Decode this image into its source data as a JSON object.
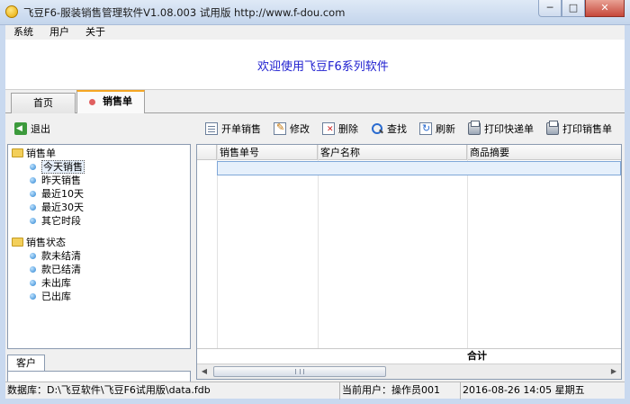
{
  "window": {
    "title": "飞豆F6-服装销售管理软件V1.08.003 试用版 http://www.f-dou.com",
    "controls": {
      "minimize": "─",
      "maximize": "□",
      "close": "✕"
    }
  },
  "menu": [
    "系统",
    "用户",
    "关于"
  ],
  "banner": {
    "welcome": "欢迎使用飞豆F6系列软件"
  },
  "tabs": [
    {
      "label": "首页",
      "active": false
    },
    {
      "label": "销售单",
      "active": true
    }
  ],
  "toolbar": {
    "exit": "退出",
    "buttons": [
      {
        "label": "开单销售",
        "icon": "new-doc-icon"
      },
      {
        "label": "修改",
        "icon": "edit-icon"
      },
      {
        "label": "删除",
        "icon": "delete-icon"
      },
      {
        "label": "查找",
        "icon": "search-icon"
      },
      {
        "label": "刷新",
        "icon": "refresh-icon"
      },
      {
        "label": "打印快递单",
        "icon": "printer-icon"
      },
      {
        "label": "打印销售单",
        "icon": "printer-icon"
      }
    ]
  },
  "tree": {
    "groups": [
      {
        "label": "销售单",
        "items": [
          "今天销售",
          "昨天销售",
          "最近10天",
          "最近30天",
          "其它时段"
        ],
        "selected": 0
      },
      {
        "label": "销售状态",
        "items": [
          "款未结清",
          "款已结清",
          "未出库",
          "已出库"
        ]
      }
    ]
  },
  "left_bottom": {
    "tab": "客户"
  },
  "grid": {
    "columns": [
      "销售单号",
      "客户名称",
      "商品摘要"
    ],
    "total_label": "合计"
  },
  "status": {
    "database": "数据库：D:\\飞豆软件\\飞豆F6试用版\\data.fdb",
    "user": "当前用户：操作员001",
    "datetime": "2016-08-26 14:05 星期五"
  }
}
